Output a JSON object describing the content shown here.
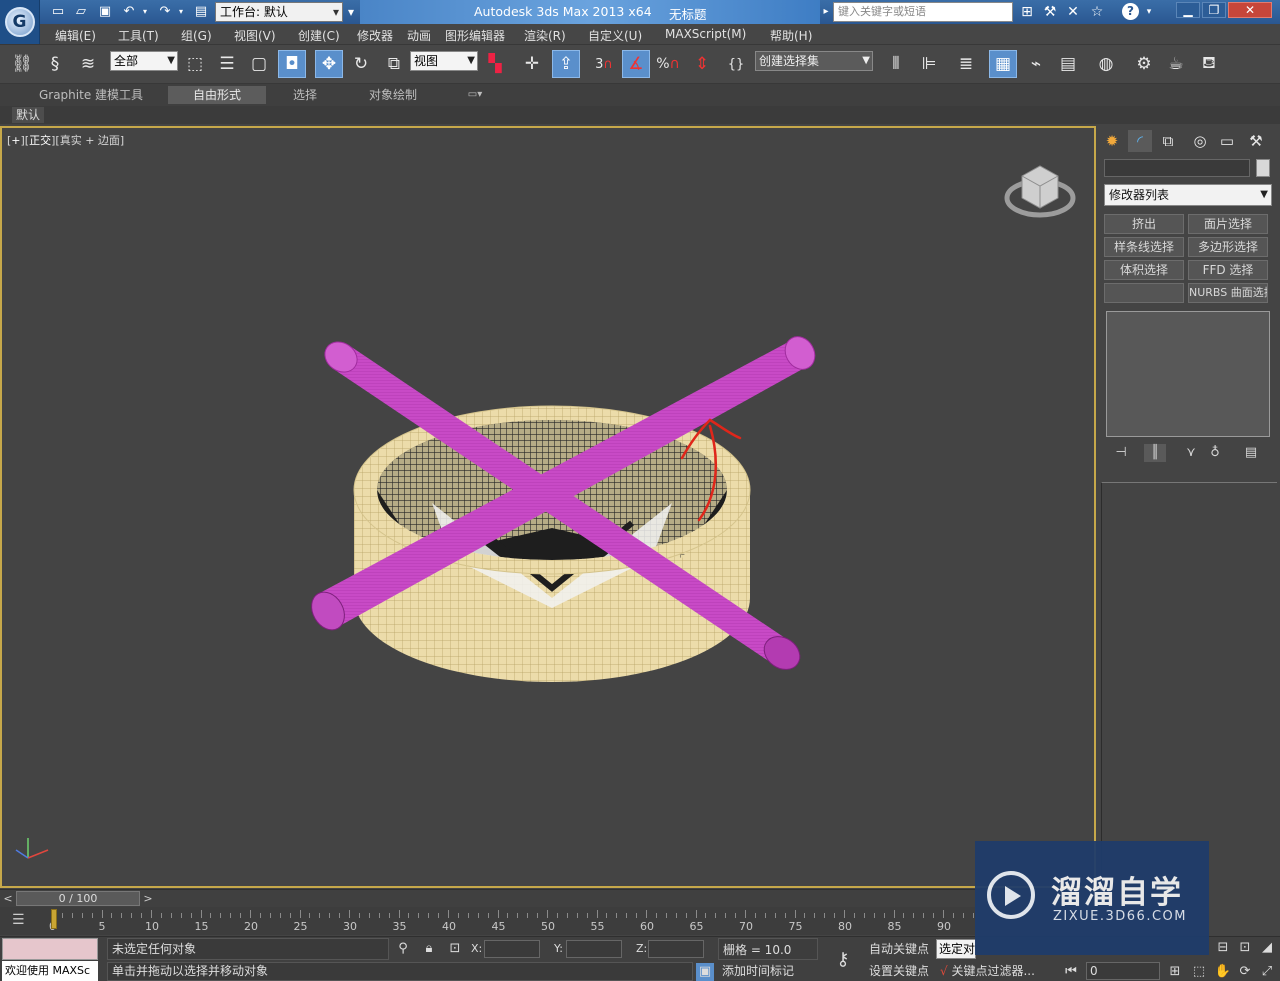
{
  "title_bar": {
    "workspace_label": "工作台: 默认",
    "app_title": "Autodesk 3ds Max  2013 x64",
    "doc_title": "无标题",
    "search_placeholder": "键入关键字或短语"
  },
  "menu": [
    "编辑(E)",
    "工具(T)",
    "组(G)",
    "视图(V)",
    "创建(C)",
    "修改器",
    "动画",
    "图形编辑器",
    "渲染(R)",
    "自定义(U)",
    "MAXScript(M)",
    "帮助(H)"
  ],
  "toolbar": {
    "selection_filter": "全部",
    "ref_coord": "视图",
    "named_selection": "创建选择集",
    "snap_value": "3",
    "percent_symbol": "%"
  },
  "ribbon": {
    "tabs": [
      "Graphite 建模工具",
      "自由形式",
      "选择",
      "对象绘制"
    ],
    "active_tab": "自由形式",
    "panel_label": "默认"
  },
  "viewport": {
    "label_plus": "+",
    "label_view": "正交",
    "label_shading": "真实 + 边面"
  },
  "command_panel": {
    "modifier_list": "修改器列表",
    "buttons": [
      "挤出",
      "面片选择",
      "样条线选择",
      "多边形选择",
      "体积选择",
      "FFD 选择",
      "",
      "NURBS 曲面选择"
    ]
  },
  "timeline": {
    "frame_display": "0 / 100",
    "ticks": [
      "0",
      "5",
      "10",
      "15",
      "20",
      "25",
      "30",
      "35",
      "40",
      "45",
      "50",
      "55",
      "60",
      "65",
      "70",
      "75",
      "80",
      "85",
      "90"
    ]
  },
  "status": {
    "selection_status": "未选定任何对象",
    "prompt": "单击并拖动以选择并移动对象",
    "welcome": "欢迎使用 MAXSc",
    "x_label": "X:",
    "y_label": "Y:",
    "z_label": "Z:",
    "grid": "栅格 = 10.0",
    "add_time_tag": "添加时间标记",
    "auto_key": "自动关键点",
    "set_key": "设置关键点",
    "selected_dropdown": "选定对",
    "key_filter": "关键点过滤器...",
    "frame_value": "0"
  },
  "watermark": {
    "title": "溜溜自学",
    "subtitle": "ZIXUE.3D66.COM"
  },
  "colors": {
    "accent": "#5a8fcb",
    "viewport_border": "#c6a84a",
    "cylinder_wire": "#e8d9a6",
    "pipe": "#c43fc2",
    "annotation": "#e0261a"
  }
}
